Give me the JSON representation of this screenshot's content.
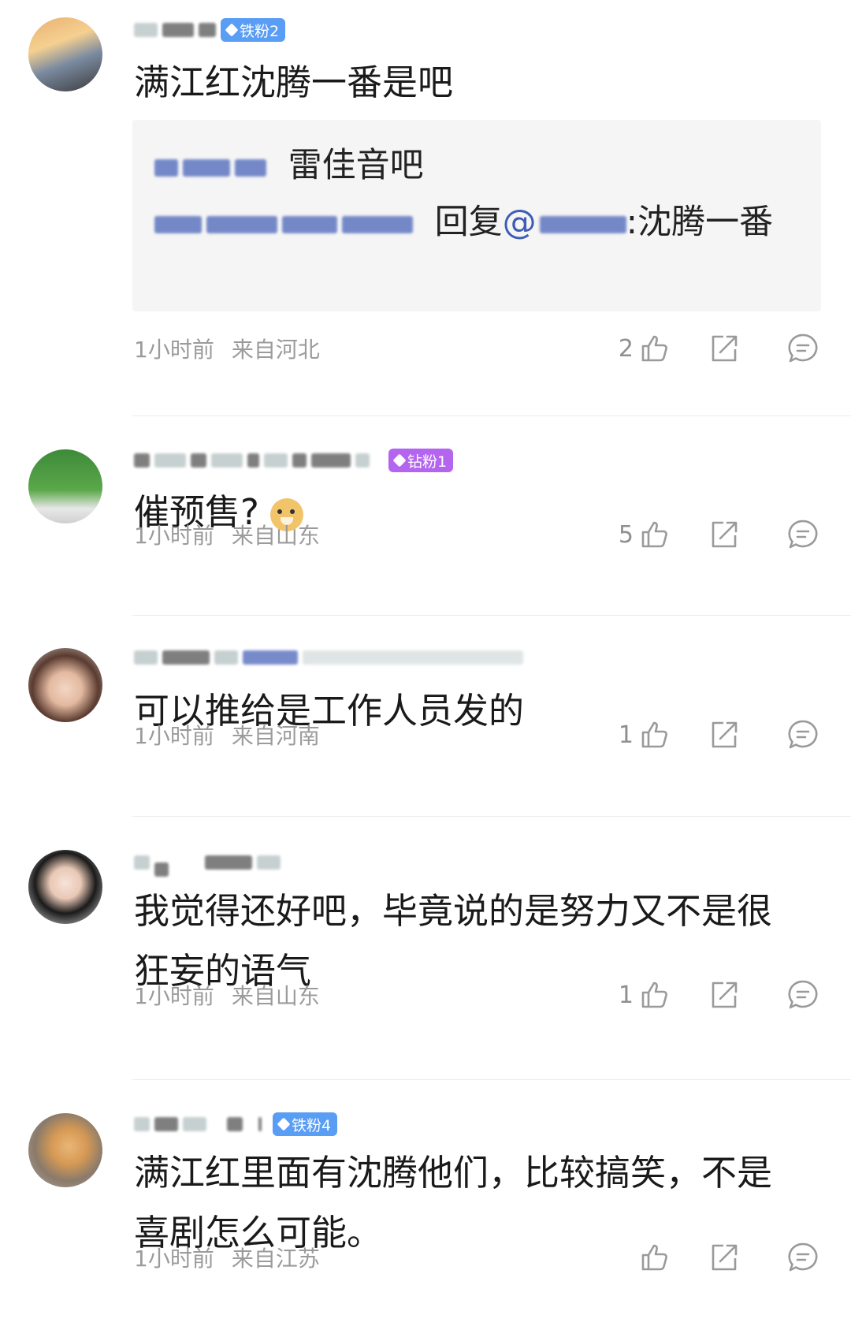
{
  "comments": [
    {
      "badge": "铁粉2",
      "text": "满江红沈腾一番是吧",
      "quote": {
        "line1_text": "雷佳音吧",
        "reply_prefix": "回复",
        "mention": "@",
        "reply_text": ":沈腾一番"
      },
      "time": "1小时前",
      "location": "来自河北",
      "likes": "2"
    },
    {
      "badge": "钻粉1",
      "text": "催预售?",
      "time": "1小时前",
      "location": "来自山东",
      "likes": "5"
    },
    {
      "text": "可以推给是工作人员发的",
      "time": "1小时前",
      "location": "来自河南",
      "likes": "1"
    },
    {
      "text": "我觉得还好吧，毕竟说的是努力又不是很狂妄的语气",
      "time": "1小时前",
      "location": "来自山东",
      "likes": "1"
    },
    {
      "badge": "铁粉4",
      "text": "满江红里面有沈腾他们，比较搞笑，不是喜剧怎么可能。",
      "time": "1小时前",
      "location": "来自江苏",
      "likes": ""
    }
  ]
}
